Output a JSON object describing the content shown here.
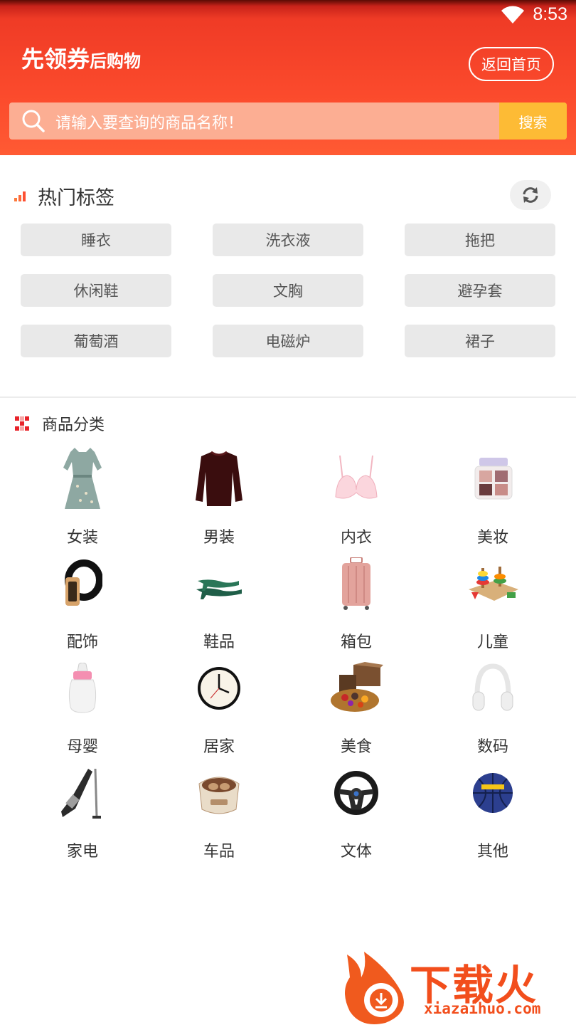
{
  "status_bar": {
    "time": "8:53",
    "wifi_icon": "wifi-icon"
  },
  "header": {
    "brand_main": "先领券",
    "brand_sub": "后购物",
    "home_button": "返回首页",
    "background_color": "#fb4a2c"
  },
  "search": {
    "placeholder": "请输入要查询的商品名称！",
    "button": "搜索",
    "button_color": "#fdbb35"
  },
  "hot_tags": {
    "title": "热门标签",
    "tags": [
      "睡衣",
      "洗衣液",
      "拖把",
      "休闲鞋",
      "文胸",
      "避孕套",
      "葡萄酒",
      "电磁炉",
      "裙子"
    ]
  },
  "categories": {
    "title": "商品分类",
    "items": [
      {
        "label": "女装",
        "icon": "dress-icon"
      },
      {
        "label": "男装",
        "icon": "shirt-icon"
      },
      {
        "label": "内衣",
        "icon": "bra-icon"
      },
      {
        "label": "美妆",
        "icon": "eyeshadow-icon"
      },
      {
        "label": "配饰",
        "icon": "belt-icon"
      },
      {
        "label": "鞋品",
        "icon": "heels-icon"
      },
      {
        "label": "箱包",
        "icon": "suitcase-icon"
      },
      {
        "label": "儿童",
        "icon": "toy-icon"
      },
      {
        "label": "母婴",
        "icon": "baby-bottle-icon"
      },
      {
        "label": "居家",
        "icon": "clock-icon"
      },
      {
        "label": "美食",
        "icon": "snacks-icon"
      },
      {
        "label": "数码",
        "icon": "headphones-icon"
      },
      {
        "label": "家电",
        "icon": "vacuum-icon"
      },
      {
        "label": "车品",
        "icon": "foot-bath-icon"
      },
      {
        "label": "文体",
        "icon": "steering-wheel-icon"
      },
      {
        "label": "其他",
        "icon": "basketball-icon"
      }
    ]
  },
  "watermark": {
    "text": "下载火",
    "url": "xiazaihuo.com"
  }
}
